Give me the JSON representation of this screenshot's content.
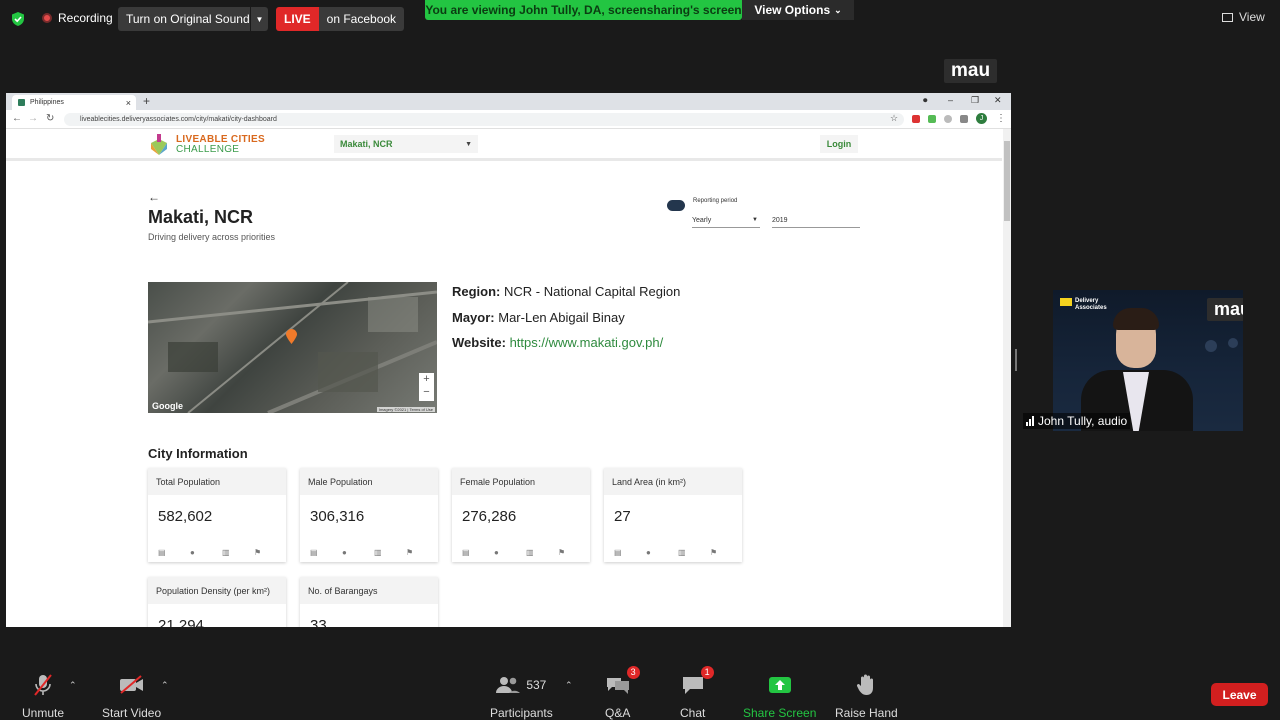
{
  "topbar": {
    "recording_label": "Recording",
    "sound_button": "Turn on Original Sound",
    "live_tag": "LIVE",
    "live_destination": "on Facebook",
    "viewing_banner": "You are viewing John Tully, DA, screensharing's screen",
    "view_options": "View Options",
    "view_label": "View"
  },
  "presenter_tag": "mau",
  "browser": {
    "tab_title": "Philippines",
    "url": "liveablecities.deliveryassociates.com/city/makati/city-dashboard",
    "profile_initial": "J"
  },
  "site": {
    "logo_line1": "LIVEABLE CITIES",
    "logo_line2": "CHALLENGE",
    "city_select": "Makati, NCR",
    "login": "Login",
    "title": "Makati, NCR",
    "subtitle": "Driving delivery across priorities",
    "reporting_label": "Reporting period",
    "period": "Yearly",
    "year": "2019",
    "map_google": "Google",
    "map_attrib": "Imagery ©2021 | Terms of Use",
    "region_label": "Region:",
    "region_value": "NCR - National Capital Region",
    "mayor_label": "Mayor:",
    "mayor_value": "Mar-Len Abigail Binay",
    "website_label": "Website:",
    "website_value": "https://www.makati.gov.ph/",
    "section_title": "City Information",
    "cards": [
      {
        "label": "Total Population",
        "value": "582,602"
      },
      {
        "label": "Male Population",
        "value": "306,316"
      },
      {
        "label": "Female Population",
        "value": "276,286"
      },
      {
        "label": "Land Area (in km²)",
        "value": "27"
      },
      {
        "label": "Population Density (per km²)",
        "value": "21,294"
      },
      {
        "label": "No. of Barangays",
        "value": "33"
      }
    ]
  },
  "webcam": {
    "tag": "mau",
    "org_line1": "Delivery",
    "org_line2": "Associates",
    "name": "John Tully, audio"
  },
  "toolbar": {
    "unmute": "Unmute",
    "start_video": "Start Video",
    "participants_count": "537",
    "participants": "Participants",
    "qa": "Q&A",
    "qa_badge": "3",
    "chat": "Chat",
    "chat_badge": "1",
    "share_screen": "Share Screen",
    "raise_hand": "Raise Hand",
    "leave": "Leave"
  },
  "colors": {
    "banner_green": "#23c542",
    "live_red": "#e02828",
    "link_green": "#2e8a3e",
    "leave_red": "#d21f1f"
  }
}
